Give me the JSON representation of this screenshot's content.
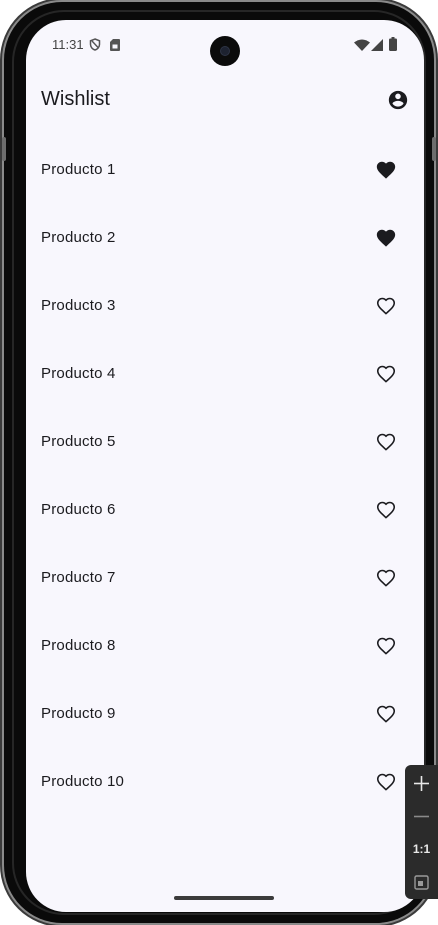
{
  "status_bar": {
    "time": "11:31",
    "icons": [
      "shield-icon",
      "sim-card-icon",
      "wifi-icon",
      "cellular-signal-icon",
      "battery-icon"
    ]
  },
  "app_bar": {
    "title": "Wishlist",
    "action_icon": "account-circle-icon"
  },
  "products": [
    {
      "label": "Producto 1",
      "favorite": true
    },
    {
      "label": "Producto 2",
      "favorite": true
    },
    {
      "label": "Producto 3",
      "favorite": false
    },
    {
      "label": "Producto 4",
      "favorite": false
    },
    {
      "label": "Producto 5",
      "favorite": false
    },
    {
      "label": "Producto 6",
      "favorite": false
    },
    {
      "label": "Producto 7",
      "favorite": false
    },
    {
      "label": "Producto 8",
      "favorite": false
    },
    {
      "label": "Producto 9",
      "favorite": false
    },
    {
      "label": "Producto 10",
      "favorite": false
    }
  ],
  "zoom_controls": {
    "ratio_label": "1:1",
    "icons": [
      "plus-icon",
      "minus-icon",
      "fit-screen-icon"
    ]
  },
  "colors": {
    "background": "#f8f7fd",
    "text": "#1b1b1f",
    "heart": "#1b1b1f"
  }
}
